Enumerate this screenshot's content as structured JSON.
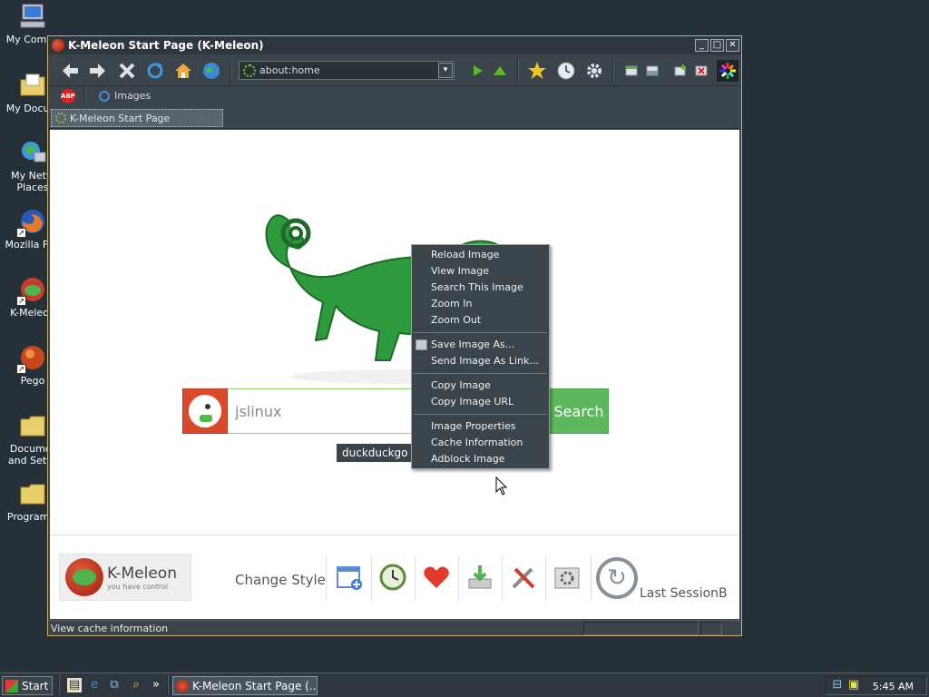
{
  "desktop": {
    "icons": [
      {
        "label": "My Compu",
        "icon": "computer-icon"
      },
      {
        "label": "My Docum",
        "icon": "documents-folder-icon"
      },
      {
        "label1": "My Netw",
        "label2": "Places",
        "icon": "network-places-icon"
      },
      {
        "label": "Mozilla Fire",
        "icon": "firefox-icon"
      },
      {
        "label": "K-Meleon",
        "icon": "kmeleon-icon"
      },
      {
        "label": "Pego",
        "icon": "pego-icon"
      },
      {
        "label1": "Documer",
        "label2": "and Settir",
        "icon": "folder-icon"
      },
      {
        "label": "Program F",
        "icon": "folder-icon"
      }
    ]
  },
  "window": {
    "title": "K-Meleon Start Page (K-Meleon)",
    "controls": {
      "minimize": "_",
      "maximize": "□",
      "close": "✕"
    },
    "url": "about:home",
    "url_dropdown": "▾",
    "linkbar": {
      "abp": "ABP",
      "images_link": "Images"
    },
    "tab_title": "K-Meleon Start Page",
    "status_text": "View cache information"
  },
  "page": {
    "search_value": "jslinux",
    "search_button": "Search",
    "tooltip": "duckduckgo",
    "logo_name": "K-Meleon",
    "logo_tagline": "you have control",
    "change_style": "Change Style",
    "last_session": "Last SessionB"
  },
  "context_menu": {
    "items": [
      "Reload Image",
      "View Image",
      "Search This Image",
      "Zoom In",
      "Zoom Out",
      "Save Image As...",
      "Send Image As Link...",
      "Copy Image",
      "Copy Image URL",
      "Image Properties",
      "Cache Information",
      "Adblock Image"
    ]
  },
  "taskbar": {
    "start": "Start",
    "task_title": "K-Meleon Start Page (...",
    "clock": "5:45 AM",
    "more": "»"
  },
  "colors": {
    "desktop_bg": "#263038",
    "chrome_bg": "#3b434b",
    "window_border": "#c9b062",
    "search_green": "#5cb85c",
    "ddg_red": "#d94a2c"
  }
}
